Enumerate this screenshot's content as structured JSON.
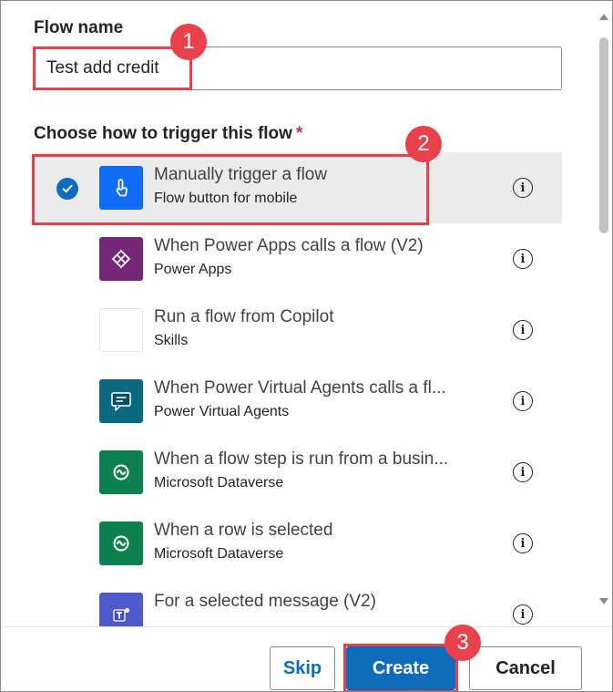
{
  "form": {
    "flow_name_label": "Flow name",
    "flow_name_value": "Test add credit",
    "trigger_label": "Choose how to trigger this flow",
    "required_marker": "*"
  },
  "annotations": {
    "badge_1": "1",
    "badge_2": "2",
    "badge_3": "3",
    "color": "#e8414b"
  },
  "triggers": [
    {
      "title": "Manually trigger a flow",
      "subtitle": "Flow button for mobile",
      "icon": "tap-hand-icon",
      "color": "#0f6cf5",
      "selected": true
    },
    {
      "title": "When Power Apps calls a flow (V2)",
      "subtitle": "Power Apps",
      "icon": "power-apps-icon",
      "color": "#742774",
      "selected": false
    },
    {
      "title": "Run a flow from Copilot",
      "subtitle": "Skills",
      "icon": "blank-icon",
      "color": "#ffffff",
      "selected": false
    },
    {
      "title": "When Power Virtual Agents calls a fl...",
      "subtitle": "Power Virtual Agents",
      "icon": "chat-bubble-icon",
      "color": "#0b6a7f",
      "selected": false
    },
    {
      "title": "When a flow step is run from a busin...",
      "subtitle": "Microsoft Dataverse",
      "icon": "dataverse-icon",
      "color": "#0d8050",
      "selected": false
    },
    {
      "title": "When a row is selected",
      "subtitle": "Microsoft Dataverse",
      "icon": "dataverse-icon",
      "color": "#0d8050",
      "selected": false
    },
    {
      "title": "For a selected message (V2)",
      "subtitle": "",
      "icon": "teams-icon",
      "color": "#5059c9",
      "selected": false
    }
  ],
  "footer": {
    "skip_label": "Skip",
    "create_label": "Create",
    "cancel_label": "Cancel"
  },
  "colors": {
    "accent": "#0f6cbd",
    "selected_row": "#ebebeb"
  }
}
